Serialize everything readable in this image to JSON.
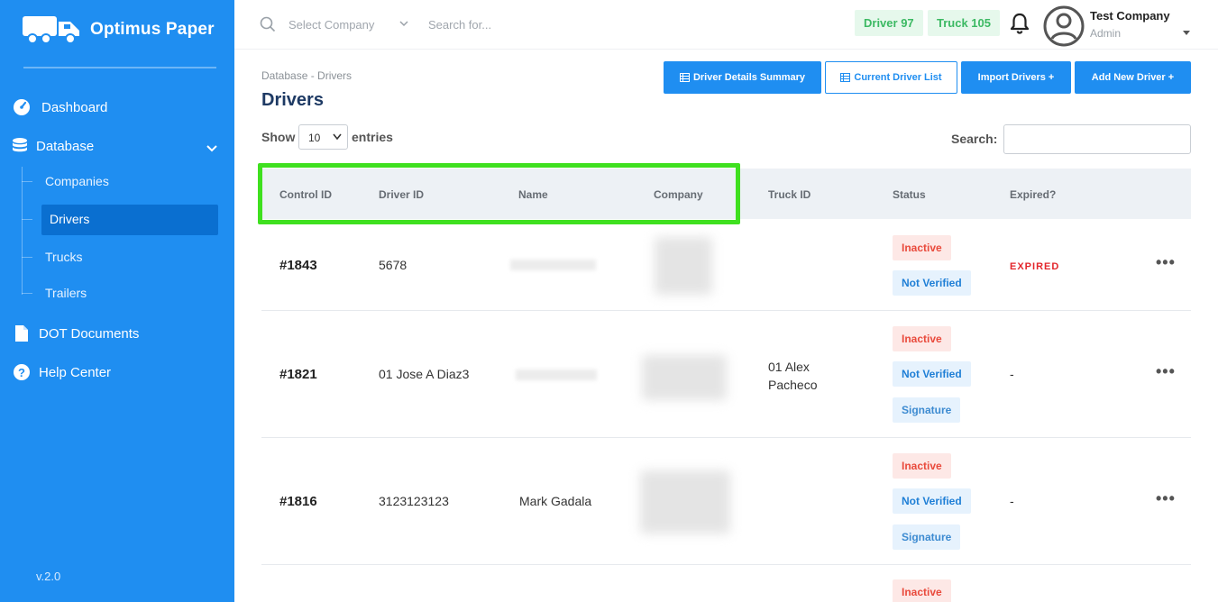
{
  "brand": {
    "name": "Optimus Paper"
  },
  "sidebar": {
    "items": [
      {
        "label": "Dashboard",
        "icon": "gauge-icon"
      },
      {
        "label": "Database",
        "icon": "database-icon"
      },
      {
        "label": "DOT Documents",
        "icon": "document-icon"
      },
      {
        "label": "Help Center",
        "icon": "help-icon"
      }
    ],
    "sub_items": [
      "Companies",
      "Drivers",
      "Trucks",
      "Trailers"
    ],
    "active_sub": "Drivers",
    "version": "v.2.0"
  },
  "topbar": {
    "select_company_placeholder": "Select Company",
    "search_placeholder": "Search for...",
    "driver_count": "Driver 97",
    "truck_count": "Truck 105",
    "user_name": "Test Company",
    "user_role": "Admin"
  },
  "page": {
    "breadcrumb": "Database - Drivers",
    "title": "Drivers",
    "buttons": {
      "summary": "Driver Details Summary",
      "current_list": "Current Driver List",
      "import": "Import Drivers +",
      "add_new": "Add New Driver +"
    }
  },
  "table_controls": {
    "show_label": "Show",
    "entries_value": "10",
    "entries_label": "entries",
    "search_label": "Search:"
  },
  "table": {
    "columns": [
      "Control ID",
      "Driver ID",
      "Name",
      "Company",
      "Truck ID",
      "Status",
      "Expired?"
    ],
    "rows": [
      {
        "control_id": "#1843",
        "driver_id": "5678",
        "truck_id": "",
        "statuses": [
          "Inactive",
          "Not Verified"
        ],
        "expired": "EXPIRED"
      },
      {
        "control_id": "#1821",
        "driver_id": "01 Jose A Diaz3",
        "truck_id": "01 Alex Pacheco",
        "statuses": [
          "Inactive",
          "Not Verified",
          "Signature"
        ],
        "expired": "-"
      },
      {
        "control_id": "#1816",
        "driver_id": "3123123123",
        "name": "Mark Gadala",
        "truck_id": "",
        "statuses": [
          "Inactive",
          "Not Verified",
          "Signature"
        ],
        "expired": "-"
      },
      {
        "statuses": [
          "Inactive"
        ]
      }
    ]
  },
  "colors": {
    "sidebar_bg": "#1f8ef1",
    "primary": "#1f8ef1",
    "highlight": "#3fe01f",
    "inactive": "#e94a3c",
    "expired": "#e3262b"
  }
}
